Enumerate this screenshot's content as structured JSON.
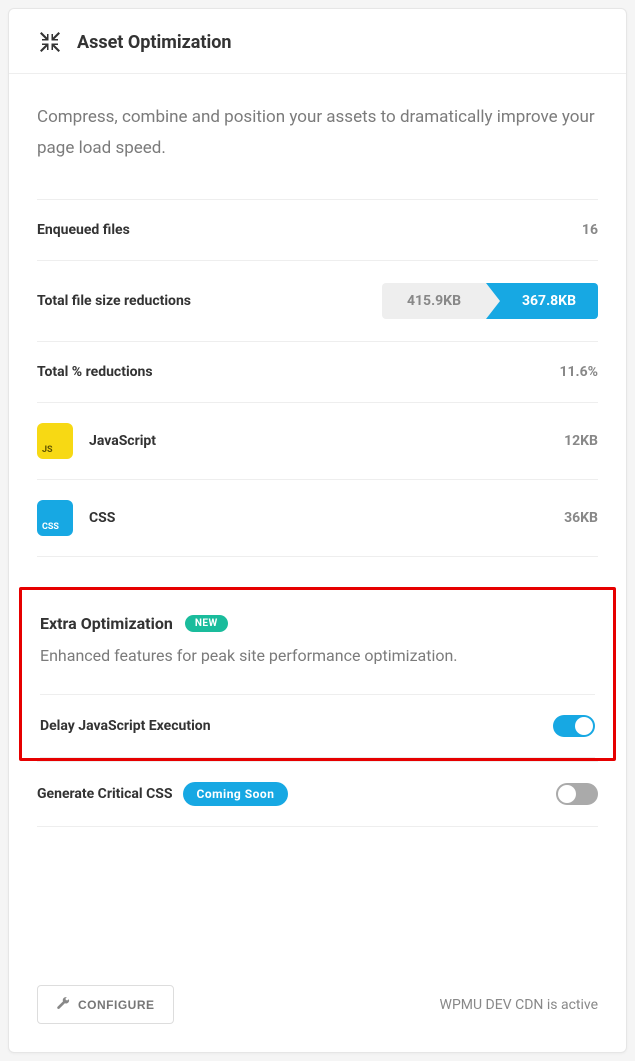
{
  "header": {
    "title": "Asset Optimization"
  },
  "description": "Compress, combine and position your assets to dramatically improve your page load speed.",
  "stats": {
    "enqueued_label": "Enqueued files",
    "enqueued_value": "16",
    "reductions_label": "Total file size reductions",
    "reductions_old": "415.9KB",
    "reductions_new": "367.8KB",
    "percent_label": "Total % reductions",
    "percent_value": "11.6%"
  },
  "assets": [
    {
      "tag": "JS",
      "label": "JavaScript",
      "size": "12KB"
    },
    {
      "tag": "CSS",
      "label": "CSS",
      "size": "36KB"
    }
  ],
  "extra": {
    "title": "Extra Optimization",
    "badge": "NEW",
    "description": "Enhanced features for peak site performance optimization.",
    "toggles": [
      {
        "label": "Delay JavaScript Execution",
        "on": true
      },
      {
        "label": "Generate Critical CSS",
        "badge": "Coming Soon",
        "on": false
      }
    ]
  },
  "footer": {
    "configure_label": "CONFIGURE",
    "status": "WPMU DEV CDN is active"
  }
}
